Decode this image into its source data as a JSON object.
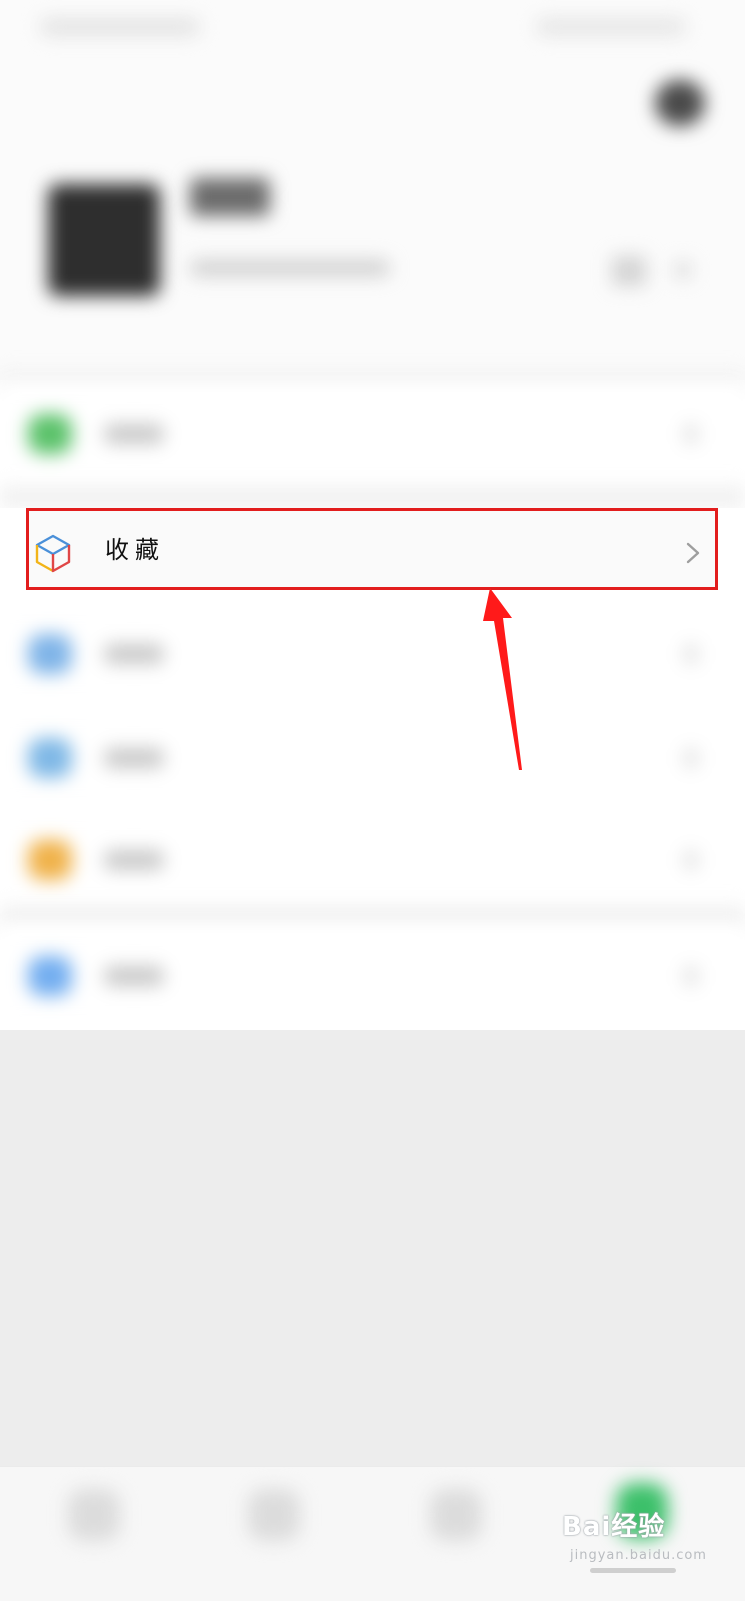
{
  "profile": {
    "statusbar_left_desc": "",
    "statusbar_right_desc": ""
  },
  "menu": {
    "favorites": {
      "label": "收藏",
      "icon": "cube-icon"
    },
    "blurred_rows": [
      {
        "icon": "pay-icon",
        "color": "#5bc26a"
      },
      {
        "icon": "moments-icon",
        "color": "#7fb4e8"
      },
      {
        "icon": "cards-icon",
        "color": "#7fb8e6"
      },
      {
        "icon": "emoji-icon",
        "color": "#f0b24a"
      },
      {
        "icon": "settings-icon",
        "color": "#73aef0"
      }
    ]
  },
  "annotation": {
    "highlight_color": "#e21d1d",
    "arrow_color": "#ff1a1a"
  },
  "watermark": {
    "text": "Bai经验",
    "sub": "jingyan.baidu.com"
  },
  "colors": {
    "accent": "#e21d1d",
    "icon_blue": "#4a90d9",
    "icon_red": "#e04646",
    "icon_yellow": "#f2b418"
  }
}
